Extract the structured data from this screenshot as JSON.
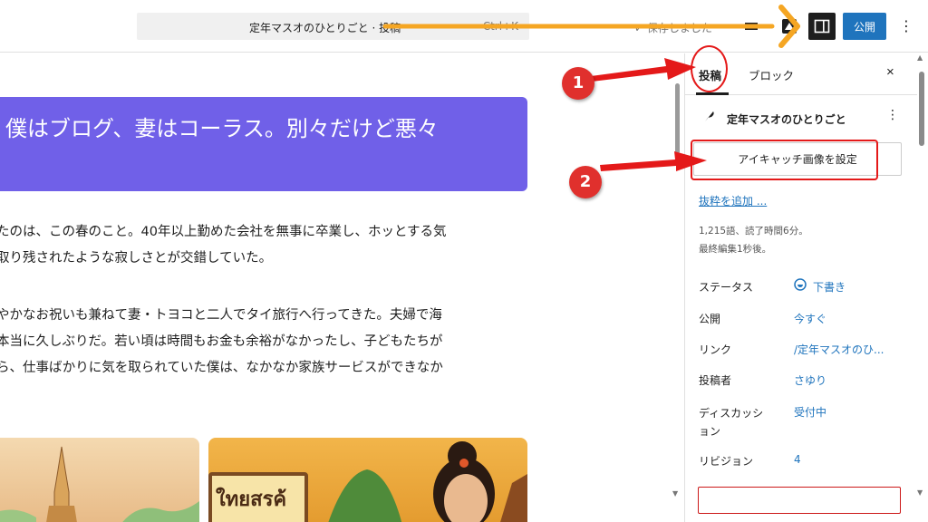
{
  "topbar": {
    "command_title": "定年マスオのひとりごと · 投稿",
    "command_shortcut": "Ctrl+K",
    "save_status": "保存しました",
    "publish_label": "公開",
    "kebab": "⋮"
  },
  "editor": {
    "title": "僕はブログ、妻はコーラス。別々だけど悪々",
    "paragraph1_line1": "たのは、この春のこと。40年以上勤めた会社を無事に卒業し、ホッとする気",
    "paragraph1_line2": "取り残されたような寂しさとが交錯していた。",
    "paragraph2_line1": "やかなお祝いも兼ねて妻・トヨコと二人でタイ旅行へ行ってきた。夫婦で海",
    "paragraph2_line2": "本当に久しぶりだ。若い頃は時間もお金も余裕がなかったし、子どもたちが",
    "paragraph2_line3": "ら、仕事ばかりに気を取られていた僕は、なかなか家族サービスができなか",
    "image2_sign": "ใทยสรค้"
  },
  "sidebar": {
    "tab_post": "投稿",
    "tab_block": "ブロック",
    "close": "×",
    "post_title": "定年マスオのひとりごと",
    "post_kebab": "⋮",
    "featured_image_button": "アイキャッチ画像を設定",
    "excerpt_link": "抜粋を追加 ...",
    "meta_words": "1,215語、読了時間6分。",
    "meta_edited": "最終編集1秒後。",
    "rows": [
      {
        "label": "ステータス",
        "value": "下書き"
      },
      {
        "label": "公開",
        "value": "今すぐ"
      },
      {
        "label": "リンク",
        "value": "/定年マスオのひ..."
      },
      {
        "label": "投稿者",
        "value": "さゆり"
      },
      {
        "label": "ディスカッション",
        "label_line1": "ディスカッシ",
        "label_line2": "ョン",
        "value": "受付中"
      },
      {
        "label": "リビジョン",
        "value": "4"
      }
    ]
  },
  "annotations": {
    "number1": "1",
    "number2": "2",
    "colors": {
      "red": "#e41919",
      "orange": "#f5a623"
    }
  },
  "colors": {
    "title_block": "#7060e8",
    "publish": "#1f74bd",
    "link": "#1f74bd"
  }
}
